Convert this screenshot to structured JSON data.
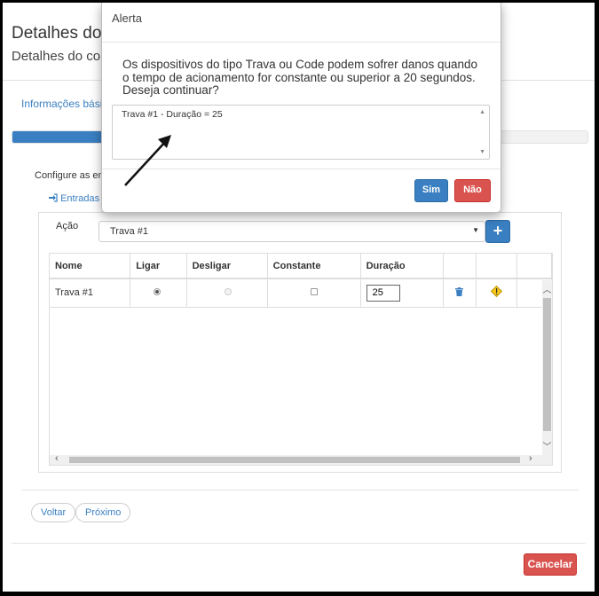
{
  "page": {
    "title": "Detalhes do",
    "subtitle": "Detalhes do con",
    "tab_label": "Informações básica",
    "progress_fraction": 0.2,
    "configure_text": "Configure as en",
    "entradas_label": "Entradas"
  },
  "form": {
    "acao_label": "Ação",
    "acao_selected": "Trava #1",
    "add_label": "+"
  },
  "table": {
    "headers": [
      "Nome",
      "Ligar",
      "Desligar",
      "Constante",
      "Duração",
      "",
      "",
      ""
    ],
    "rows": [
      {
        "nome": "Trava #1",
        "ligar": true,
        "desligar": false,
        "constante": false,
        "duracao": "25"
      }
    ]
  },
  "footer": {
    "voltar_label": "Voltar",
    "proximo_label": "Próximo",
    "cancelar_label": "Cancelar"
  },
  "modal": {
    "title": "Alerta",
    "message": "Os dispositivos do tipo Trava ou Code podem sofrer danos quando o tempo de acionamento for constante ou superior a 20 segundos. Deseja continuar?",
    "details": "Trava #1 - Duração = 25",
    "sim_label": "Sim",
    "nao_label": "Não"
  },
  "icons": {
    "entradas": "sign-in-icon",
    "delete": "trash-icon",
    "warning": "warning-diamond-icon"
  },
  "colors": {
    "primary": "#3a7fc1",
    "danger": "#d9534f",
    "warning": "#f5c518"
  }
}
